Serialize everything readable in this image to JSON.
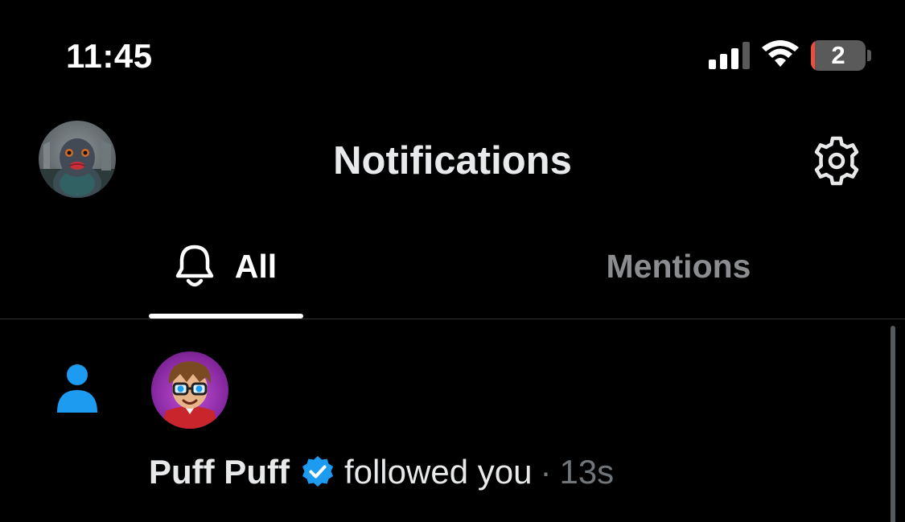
{
  "status_bar": {
    "time": "11:45",
    "battery_level": "2",
    "battery_fraction": 0.02,
    "signal_bars_active": 3,
    "signal_bars_total": 4,
    "icons": [
      "cellular-signal-icon",
      "wifi-icon",
      "battery-icon"
    ]
  },
  "header": {
    "title": "Notifications",
    "avatar_icon": "profile-avatar",
    "settings_icon": "gear-icon"
  },
  "tabs": [
    {
      "label": "All",
      "icon": "bell-icon",
      "selected": true
    },
    {
      "label": "Mentions",
      "selected": false
    }
  ],
  "notifications": [
    {
      "type_icon": "person-icon",
      "user_name": "Puff Puff",
      "verified": true,
      "action": "followed you",
      "separator": "·",
      "time": "13s"
    }
  ],
  "colors": {
    "background": "#000000",
    "text_primary": "#e7e9ea",
    "text_secondary": "#71767b",
    "accent": "#1d9bf0",
    "divider": "#2f3336",
    "battery_low": "#eb4e3d"
  }
}
